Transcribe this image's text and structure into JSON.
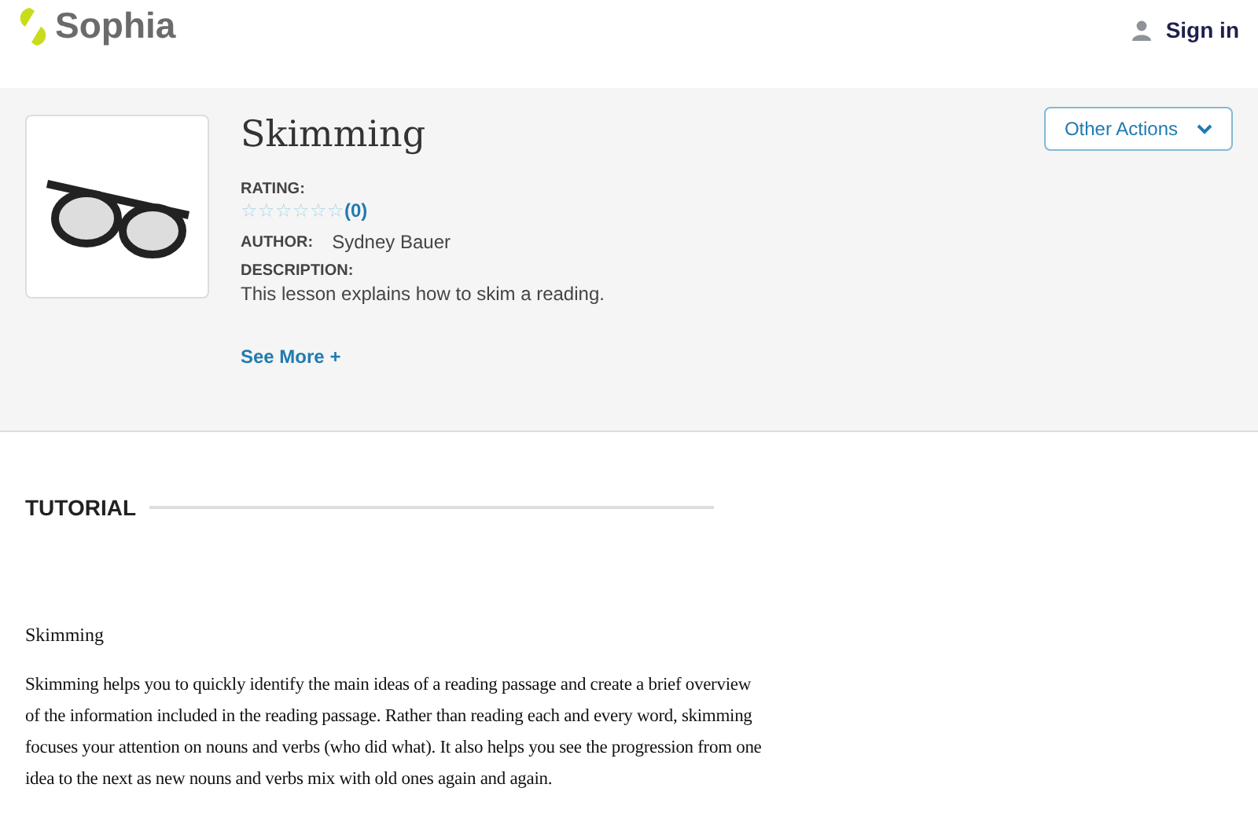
{
  "header": {
    "logo": "Sophia",
    "sign_in": "Sign in"
  },
  "lesson": {
    "title": "Skimming",
    "rating_label": "RATING:",
    "stars": 0,
    "rating_count": "(0)",
    "author_label": "AUTHOR:",
    "author": "Sydney Bauer",
    "description_label": "DESCRIPTION:",
    "description": "This lesson explains how to skim a reading.",
    "see_more": "See More +",
    "other_actions": "Other Actions"
  },
  "tutorial": {
    "heading": "TUTORIAL",
    "title": "Skimming",
    "paragraph": "Skimming helps you to quickly identify the main ideas of a reading passage and create a brief overview of the information included in the reading passage. Rather than reading each and every word, skimming focuses your attention on nouns and verbs (who did what). It also helps you see the progression from one idea to the next as new nouns and verbs mix with old ones again and again."
  }
}
